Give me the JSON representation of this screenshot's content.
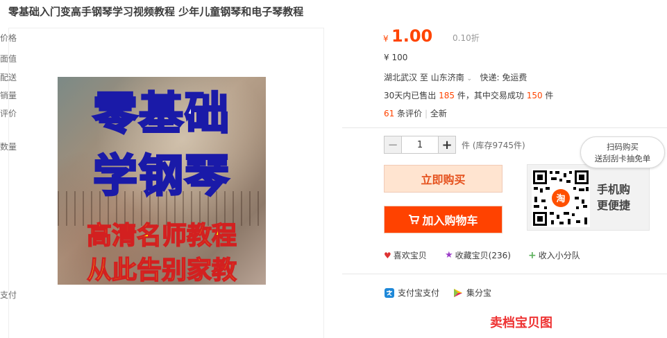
{
  "title": "零基础入门变高手钢琴学习视频教程 少年儿童钢琴和电子琴教程",
  "cover": {
    "line1": "零基础",
    "line2": "学钢琴",
    "line3": "高清名师教程",
    "line4": "从此告别家教"
  },
  "price": {
    "label": "价格",
    "currency": "¥",
    "value": "1.00",
    "discount": "0.10折"
  },
  "face_value": {
    "label": "面值",
    "value": "¥ 100"
  },
  "delivery": {
    "label": "配送",
    "from": "湖北武汉",
    "to_word": "至",
    "to": "山东济南",
    "method": "快递: 免运费"
  },
  "sales": {
    "label": "销量",
    "prefix": "30天内已售出",
    "sold": "185",
    "mid": "件，其中交易成功",
    "success": "150",
    "suffix": "件"
  },
  "reviews": {
    "label": "评价",
    "count": "61",
    "unit": "条评价",
    "sep": "|",
    "condition": "全新"
  },
  "quantity": {
    "label": "数量",
    "minus": "−",
    "value": "1",
    "plus": "+",
    "note": "件 (库存9745件)"
  },
  "buttons": {
    "buy_now": "立即购买",
    "add_cart": "加入购物车"
  },
  "mobile": {
    "bubble_l1": "扫码购买",
    "bubble_l2": "送刮刮卡抽免单",
    "text_l1": "手机购",
    "text_l2": "更便捷",
    "qr_badge": "淘"
  },
  "actions": [
    {
      "label": "喜欢宝贝"
    },
    {
      "label": "收藏宝贝(236)"
    },
    {
      "label": "收入小分队"
    }
  ],
  "payment": {
    "label": "支付",
    "alipay": "支付宝支付",
    "jifen": "集分宝"
  },
  "bottom_cut": "卖档宝贝图",
  "colors": {
    "accent": "#ff4400",
    "buy_bg": "#ffe4d0",
    "cart_bg": "#ff4200"
  }
}
